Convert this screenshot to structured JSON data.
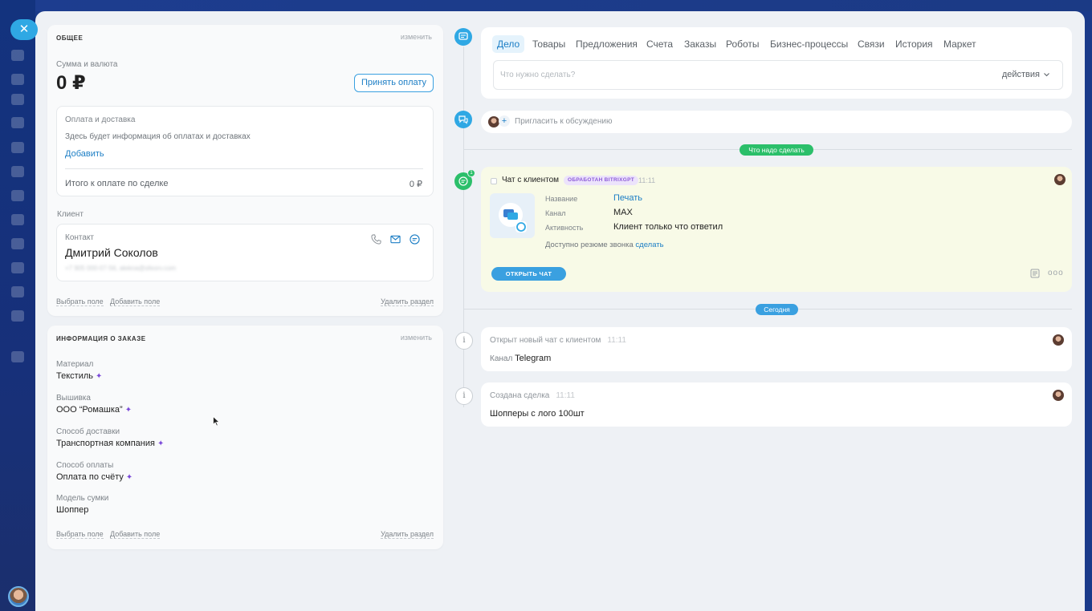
{
  "general": {
    "title": "ОБЩЕЕ",
    "edit": "изменить",
    "amount_label": "Сумма и валюта",
    "amount_value": "0 ₽",
    "accept_payment": "Принять оплату",
    "payment_delivery_title": "Оплата и доставка",
    "payment_delivery_hint": "Здесь будет информация об оплатах и доставках",
    "add_link": "Добавить",
    "total_label": "Итого к оплате по сделке",
    "total_value": "0 ₽",
    "client_label": "Клиент",
    "contact_label": "Контакт",
    "contact_name": "Дмитрий Соколов",
    "contact_details": "+7 905 000-07-56, alekna@sfeorv.com",
    "select_field": "Выбрать поле",
    "add_field": "Добавить поле",
    "delete_section": "Удалить раздел"
  },
  "order_info": {
    "title": "ИНФОРМАЦИЯ О ЗАКАЗЕ",
    "edit": "изменить",
    "fields": [
      {
        "label": "Материал",
        "value": "Текстиль"
      },
      {
        "label": "Вышивка",
        "value": "ООО “Ромашка”"
      },
      {
        "label": "Способ доставки",
        "value": "Транспортная компания"
      },
      {
        "label": "Способ оплаты",
        "value": "Оплата по счёту"
      },
      {
        "label": "Модель сумки",
        "value": "Шоппер"
      }
    ],
    "select_field": "Выбрать поле",
    "add_field": "Добавить поле",
    "delete_section": "Удалить раздел"
  },
  "tabs": [
    "Дело",
    "Товары",
    "Предложения",
    "Счета",
    "Заказы",
    "Роботы",
    "Бизнес-процессы",
    "Связи",
    "История",
    "Маркет"
  ],
  "todo": {
    "placeholder": "Что нужно сделать?",
    "actions": "действия"
  },
  "invite": "Пригласить к обсуждению",
  "section_todo": "Что надо сделать",
  "activity": {
    "title": "Чат с клиентом",
    "badge": "ОБРАБОТАН BITRIXGPT",
    "time": "11:11",
    "counter": "1",
    "rows": [
      {
        "label": "Название",
        "value": "Печать"
      },
      {
        "label": "Канал",
        "value": "MAX"
      },
      {
        "label": "Активность",
        "value": "Клиент только что ответил"
      }
    ],
    "resume_text": "Доступно резюме звонка",
    "resume_link": "сделать",
    "open_chat": "ОТКРЫТЬ ЧАТ"
  },
  "section_today": "Сегодня",
  "history": [
    {
      "title": "Открыт новый чат с клиентом",
      "time": "11:11",
      "label": "Канал",
      "value": "Telegram"
    },
    {
      "title": "Создана сделка",
      "time": "11:11",
      "value": "Шопперы с лого 100шт"
    }
  ],
  "colors": {
    "accent": "#2fa8e4",
    "green": "#2bbf6a",
    "ai_purple": "#7b4ad9",
    "activity_bg": "#f8fae7"
  }
}
